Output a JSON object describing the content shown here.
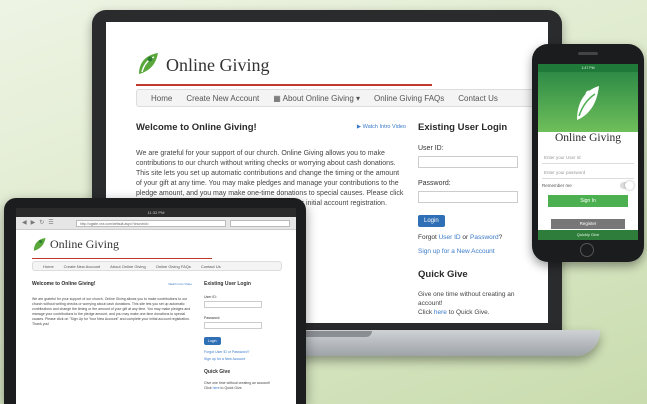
{
  "site": {
    "brand": "Online Giving",
    "nav": [
      "Home",
      "Create New Account",
      "About Online Giving",
      "Online Giving FAQs",
      "Contact Us"
    ],
    "welcome_title": "Welcome to Online Giving!",
    "video_link": "Watch Intro Video",
    "welcome_text": "We are grateful for your support of our church. Online Giving allows you to make contributions to our church without writing checks or worrying about cash donations. This site lets you set up automatic contributions and change the timing or the amount of your gift at any time. You may make pledges and manage your contributions to the pledge amount, and you may make one-time donations to special causes. Please click on \"Sign Up for Your New Account\" and complete your initial account registration. Thank you!",
    "login_title": "Existing User Login",
    "user_id_label": "User ID:",
    "password_label": "Password:",
    "login_button": "Login",
    "forgot_prefix": "Forgot ",
    "forgot_user_id": "User ID",
    "forgot_or": " or ",
    "forgot_password": "Password",
    "forgot_suffix": "?",
    "signup_link": "Sign up for a New Account",
    "quick_give_title": "Quick Give",
    "quick_give_text_1": "Give one time without creating an account!",
    "quick_give_text_2_prefix": "Click ",
    "quick_give_here": "here",
    "quick_give_text_2_suffix": " to Quick Give."
  },
  "tablet": {
    "status_time": "11:32 PM",
    "url": "http://ogsite.xxx.com/default.aspx?churchid="
  },
  "phone": {
    "status": "1:47 PM",
    "brand": "Online Giving",
    "user_placeholder": "Enter your User Id",
    "password_placeholder": "Enter your password",
    "remember_me": "Remember me",
    "signin_button": "Sign In",
    "register_button": "Register",
    "footer_link": "Quickly Give"
  },
  "colors": {
    "accent_green": "#4caf50",
    "brand_red": "#c0392b",
    "link_blue": "#3a7bc8",
    "button_blue": "#2f6fb5"
  }
}
